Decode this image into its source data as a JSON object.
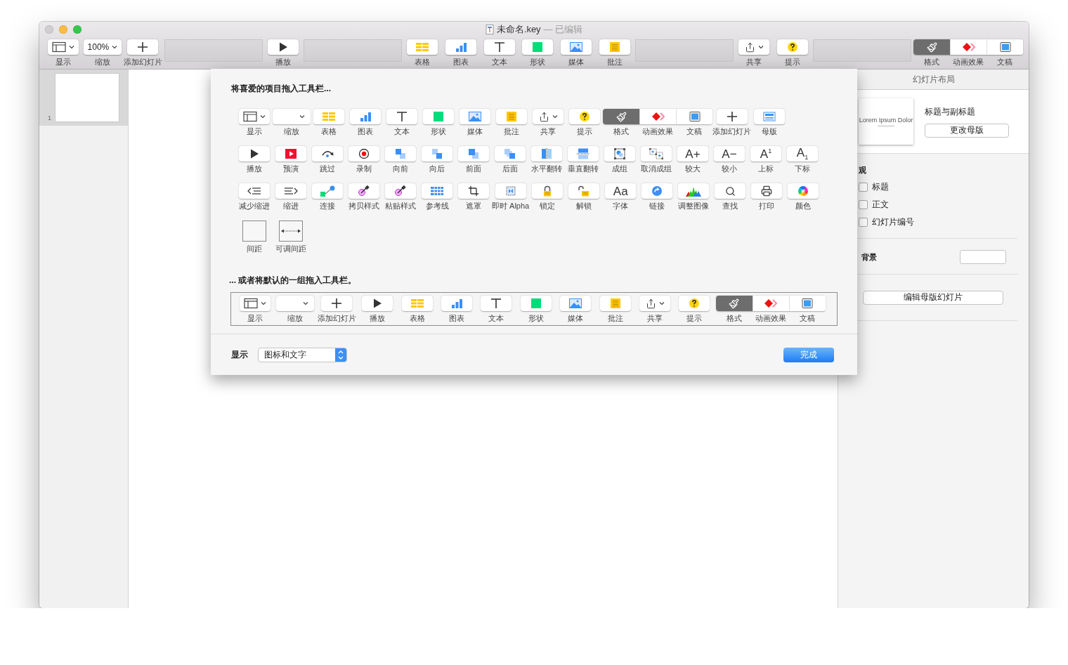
{
  "window": {
    "title": "未命名.key",
    "status": "— 已编辑",
    "lights": [
      {
        "kind": "close",
        "disabled": true
      },
      {
        "kind": "minimize",
        "disabled": false
      },
      {
        "kind": "zoom",
        "disabled": false
      }
    ]
  },
  "toolbar": [
    {
      "kind": "view",
      "label": "显示"
    },
    {
      "kind": "zoom",
      "label": "缩放",
      "value": "100%"
    },
    {
      "kind": "add",
      "label": "添加幻灯片"
    },
    {
      "kind": "gap"
    },
    {
      "kind": "play",
      "label": "播放"
    },
    {
      "kind": "gap"
    },
    {
      "kind": "table",
      "label": "表格"
    },
    {
      "kind": "chart",
      "label": "图表"
    },
    {
      "kind": "text",
      "label": "文本"
    },
    {
      "kind": "shape",
      "label": "形状"
    },
    {
      "kind": "media",
      "label": "媒体"
    },
    {
      "kind": "comment",
      "label": "批注"
    },
    {
      "kind": "gap"
    },
    {
      "kind": "share",
      "label": "共享"
    },
    {
      "kind": "help",
      "label": "提示"
    },
    {
      "kind": "gap"
    },
    {
      "kind": "segment",
      "segments": [
        {
          "kind": "format",
          "label": "格式",
          "selected": true
        },
        {
          "kind": "animate",
          "label": "动画效果",
          "selected": false
        },
        {
          "kind": "document",
          "label": "文稿",
          "selected": false
        }
      ]
    }
  ],
  "navigator": {
    "slides": [
      {
        "number": "1",
        "selected": true
      }
    ]
  },
  "inspector": {
    "tab": "幻灯片布局",
    "thumb_text": "Lorem Ipsum Dolor",
    "layout_name": "标题与副标题",
    "change_master": "更改母版",
    "appearance": "观",
    "options": [
      {
        "label": "标题",
        "checked": false
      },
      {
        "label": "正文",
        "checked": false
      },
      {
        "label": "幻灯片编号",
        "checked": false
      }
    ],
    "background": "背景",
    "edit_master": "编辑母版幻灯片"
  },
  "sheet": {
    "heading": "将喜爱的项目拖入工具栏...",
    "palette": [
      [
        {
          "kind": "view",
          "label": "显示"
        },
        {
          "kind": "zoom",
          "label": "缩放"
        },
        {
          "kind": "table",
          "label": "表格"
        },
        {
          "kind": "chart",
          "label": "图表"
        },
        {
          "kind": "text",
          "label": "文本"
        },
        {
          "kind": "shape",
          "label": "形状"
        },
        {
          "kind": "media",
          "label": "媒体"
        },
        {
          "kind": "comment",
          "label": "批注"
        },
        {
          "kind": "share",
          "label": "共享"
        },
        {
          "kind": "help",
          "label": "提示"
        },
        {
          "kind": "segment",
          "segments": [
            {
              "kind": "format",
              "label": "格式",
              "selected": true
            },
            {
              "kind": "animate",
              "label": "动画效果",
              "selected": false
            },
            {
              "kind": "document",
              "label": "文稿",
              "selected": false
            }
          ]
        },
        {
          "kind": "add",
          "label": "添加幻灯片"
        },
        {
          "kind": "master",
          "label": "母版"
        }
      ],
      [
        {
          "kind": "play",
          "label": "播放"
        },
        {
          "kind": "rehearse",
          "label": "预演"
        },
        {
          "kind": "skip",
          "label": "跳过"
        },
        {
          "kind": "record",
          "label": "录制"
        },
        {
          "kind": "forward",
          "label": "向前"
        },
        {
          "kind": "backward",
          "label": "向后"
        },
        {
          "kind": "front",
          "label": "前面"
        },
        {
          "kind": "back",
          "label": "后面"
        },
        {
          "kind": "fliph",
          "label": "水平翻转"
        },
        {
          "kind": "flipv",
          "label": "垂直翻转"
        },
        {
          "kind": "group",
          "label": "成组"
        },
        {
          "kind": "ungroup",
          "label": "取消成组"
        },
        {
          "kind": "glyph",
          "glyph": "A+",
          "label": "较大"
        },
        {
          "kind": "glyph",
          "glyph": "A−",
          "label": "较小"
        },
        {
          "kind": "glyph",
          "glyph": "A$^{1}$",
          "label": "上标"
        },
        {
          "kind": "glyph",
          "glyph": "A$_{1}$",
          "label": "下标"
        }
      ],
      [
        {
          "kind": "outdent",
          "label": "减少缩进"
        },
        {
          "kind": "indent",
          "label": "缩进"
        },
        {
          "kind": "connect",
          "label": "连接"
        },
        {
          "kind": "copystyle",
          "label": "拷贝样式"
        },
        {
          "kind": "pastestyle",
          "label": "粘贴样式"
        },
        {
          "kind": "guides",
          "label": "参考线"
        },
        {
          "kind": "mask",
          "label": "遮罩"
        },
        {
          "kind": "alpha",
          "label": "即时 Alpha"
        },
        {
          "kind": "lock",
          "label": "锁定"
        },
        {
          "kind": "unlock",
          "label": "解锁"
        },
        {
          "kind": "glyph",
          "glyph": "Aa",
          "label": "字体"
        },
        {
          "kind": "link",
          "label": "链接"
        },
        {
          "kind": "adjust",
          "label": "调整图像"
        },
        {
          "kind": "find",
          "label": "查找"
        },
        {
          "kind": "print",
          "label": "打印"
        },
        {
          "kind": "colors",
          "label": "颜色"
        }
      ],
      [
        {
          "kind": "space",
          "label": "间距"
        },
        {
          "kind": "flexspace",
          "label": "可调间距"
        }
      ]
    ],
    "default_heading": "... 或者将默认的一组拖入工具栏。",
    "default_set": [
      {
        "kind": "view",
        "label": "显示"
      },
      {
        "kind": "zoom",
        "label": "缩放"
      },
      {
        "kind": "add",
        "label": "添加幻灯片"
      },
      {
        "kind": "play",
        "label": "播放"
      },
      {
        "kind": "table",
        "label": "表格"
      },
      {
        "kind": "chart",
        "label": "图表"
      },
      {
        "kind": "text",
        "label": "文本"
      },
      {
        "kind": "shape",
        "label": "形状"
      },
      {
        "kind": "media",
        "label": "媒体"
      },
      {
        "kind": "comment",
        "label": "批注"
      },
      {
        "kind": "share",
        "label": "共享"
      },
      {
        "kind": "help",
        "label": "提示"
      },
      {
        "kind": "segment",
        "segments": [
          {
            "kind": "format",
            "label": "格式",
            "selected": true
          },
          {
            "kind": "animate",
            "label": "动画效果",
            "selected": false
          },
          {
            "kind": "document",
            "label": "文稿",
            "selected": false
          }
        ]
      }
    ],
    "show_label": "显示",
    "show_value": "图标和文字",
    "done": "完成"
  }
}
